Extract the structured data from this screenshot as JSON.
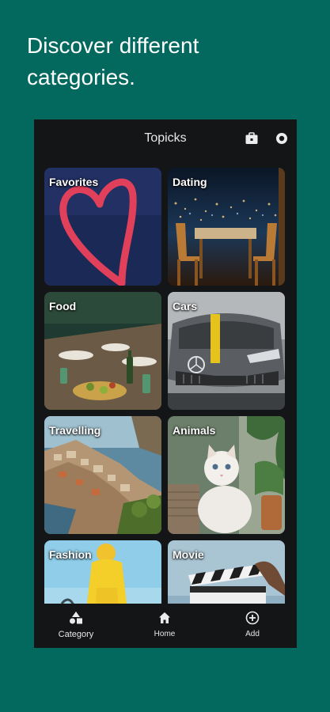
{
  "headline": "Discover different categories.",
  "app": {
    "title": "Topicks",
    "actions": [
      {
        "name": "briefcase-icon"
      },
      {
        "name": "settings-icon"
      }
    ]
  },
  "categories": [
    {
      "label": "Favorites"
    },
    {
      "label": "Dating"
    },
    {
      "label": "Food"
    },
    {
      "label": "Cars"
    },
    {
      "label": "Travelling"
    },
    {
      "label": "Animals"
    },
    {
      "label": "Fashion"
    },
    {
      "label": "Movie"
    }
  ],
  "bottom_nav": {
    "items": [
      {
        "label": "Category",
        "icon": "category-icon",
        "active": true
      },
      {
        "label": "Home",
        "icon": "home-icon",
        "active": false
      },
      {
        "label": "Add",
        "icon": "add-circle-icon",
        "active": false
      }
    ]
  },
  "colors": {
    "background": "#03685e",
    "screen": "#141517",
    "text": "#ffffff"
  }
}
